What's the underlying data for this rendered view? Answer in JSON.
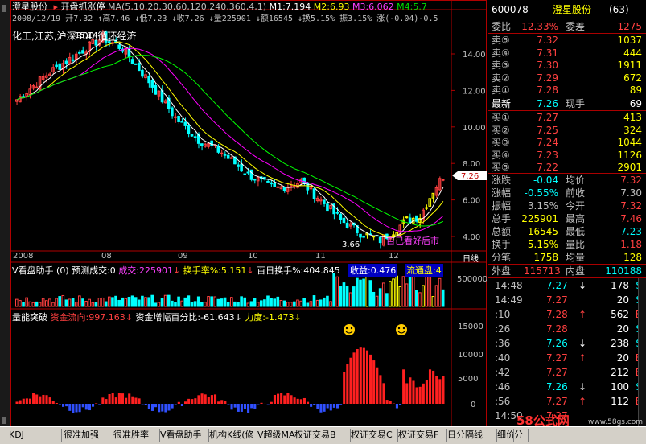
{
  "chart_header": {
    "stock_name": "澄星股份",
    "indicator_name": "开盘抓涨停",
    "ma_label": "MA(5,10,20,30,60,120,240,360,4,1)",
    "m1": "M1:7.194",
    "m2": "M2:6.93",
    "m3": "M3:6.062",
    "m4": "M4:5.7",
    "ohlc_line": "2008/12/19 开7.32 ↑高7.46 ↓低7.23 ↓收7.26 ↓量225901 ↓额16545 ↓换5.15% 振3.15% 涨(-0.04)-0.5",
    "sectors": "化工,江苏,沪深300,循环经济"
  },
  "price_axis": {
    "ticks": [
      "14.00",
      "12.00",
      "10.00",
      "8.00",
      "6.00",
      "4.00"
    ],
    "current_price": "7.26"
  },
  "price_annotations": {
    "high_label": "15.14",
    "low_label": "3.66",
    "note": "自己看好后市"
  },
  "time_axis": {
    "labels": [
      "2008",
      "08",
      "09",
      "10",
      "11",
      "12"
    ],
    "period": "日线"
  },
  "volume_panel": {
    "title": "V看盘助手 (0) 预测成交:0",
    "volume": "成交:225901",
    "turnover": "换手率%:5.151",
    "hundred_day": "百日换手%:404.845",
    "income": "收益:0.476",
    "float_cap": "流通盘:4",
    "axis_tick": "500000"
  },
  "flow_panel": {
    "title": "量能突破",
    "fund_flow": "资金流向:997.163",
    "fund_pct": "资金增幅百分比:-61.643",
    "force": "力度:-1.473",
    "axis_ticks": [
      "15000",
      "10000",
      "5000",
      "0"
    ]
  },
  "quote": {
    "code": "600078",
    "name": "澄星股份",
    "count": "(63)",
    "weibi_label": "委比",
    "weibi_value": "12.33%",
    "weicha_label": "委差",
    "weicha_value": "1275",
    "asks": [
      {
        "label": "卖⑤",
        "price": "7.32",
        "vol": "1037"
      },
      {
        "label": "卖④",
        "price": "7.31",
        "vol": "444"
      },
      {
        "label": "卖③",
        "price": "7.30",
        "vol": "1911"
      },
      {
        "label": "卖②",
        "price": "7.29",
        "vol": "672"
      },
      {
        "label": "卖①",
        "price": "7.28",
        "vol": "89"
      }
    ],
    "last_label": "最新",
    "last_price": "7.26",
    "hand_label": "现手",
    "hand_value": "69",
    "bids": [
      {
        "label": "买①",
        "price": "7.27",
        "vol": "413"
      },
      {
        "label": "买②",
        "price": "7.25",
        "vol": "324"
      },
      {
        "label": "买③",
        "price": "7.24",
        "vol": "1044"
      },
      {
        "label": "买④",
        "price": "7.23",
        "vol": "1126"
      },
      {
        "label": "买⑤",
        "price": "7.22",
        "vol": "2901"
      }
    ],
    "stats": [
      {
        "l1": "涨跌",
        "v1": "-0.04",
        "l2": "均价",
        "v2": "7.32"
      },
      {
        "l1": "涨幅",
        "v1": "-0.55%",
        "l2": "前收",
        "v2": "7.30"
      },
      {
        "l1": "振幅",
        "v1": "3.15%",
        "l2": "今开",
        "v2": "7.32"
      },
      {
        "l1": "总手",
        "v1": "225901",
        "l2": "最高",
        "v2": "7.46"
      },
      {
        "l1": "总额",
        "v1": "16545",
        "l2": "最低",
        "v2": "7.23"
      },
      {
        "l1": "换手",
        "v1": "5.15%",
        "l2": "量比",
        "v2": "1.18"
      },
      {
        "l1": "分笔",
        "v1": "1758",
        "l2": "均量",
        "v2": "128"
      }
    ],
    "outer_label": "外盘",
    "outer_value": "115713",
    "inner_label": "内盘",
    "inner_value": "110188"
  },
  "ticks": [
    {
      "time": "14:48",
      "price": "7.27",
      "arrow": "↓",
      "vol": "178",
      "side": "S"
    },
    {
      "time": "14:49",
      "price": "7.27",
      "arrow": "",
      "vol": "20",
      "side": "S"
    },
    {
      "time": ":10",
      "price": "7.28",
      "arrow": "↑",
      "vol": "562",
      "side": "B"
    },
    {
      "time": ":26",
      "price": "7.28",
      "arrow": "",
      "vol": "20",
      "side": "S"
    },
    {
      "time": ":36",
      "price": "7.26",
      "arrow": "↓",
      "vol": "238",
      "side": "S"
    },
    {
      "time": ":40",
      "price": "7.27",
      "arrow": "↑",
      "vol": "20",
      "side": "B"
    },
    {
      "time": ":42",
      "price": "7.27",
      "arrow": "",
      "vol": "212",
      "side": "B"
    },
    {
      "time": ":46",
      "price": "7.26",
      "arrow": "↓",
      "vol": "100",
      "side": "S"
    },
    {
      "time": ":56",
      "price": "7.27",
      "arrow": "↑",
      "vol": "112",
      "side": "B"
    },
    {
      "time": "14:50",
      "price": "7.27",
      "arrow": "",
      "vol": "",
      "side": ""
    }
  ],
  "bottom_tabs": [
    "KDJ",
    "很准加强",
    "很准胜率",
    "V看盘助手",
    "机构K线(修",
    "V超级MACD",
    "权证交易B",
    "权证交易C",
    "权证交易F",
    "日分隔线",
    "细价",
    "分"
  ],
  "watermark": {
    "text": "58公式网",
    "url": "www.58gs.com"
  },
  "colors": {
    "up": "#ff4040",
    "down": "#00ffff",
    "ma5": "#ffffff",
    "ma10": "#ffff00",
    "ma20": "#ff00ff",
    "ma30": "#00ff00",
    "frame": "#b00000"
  }
}
